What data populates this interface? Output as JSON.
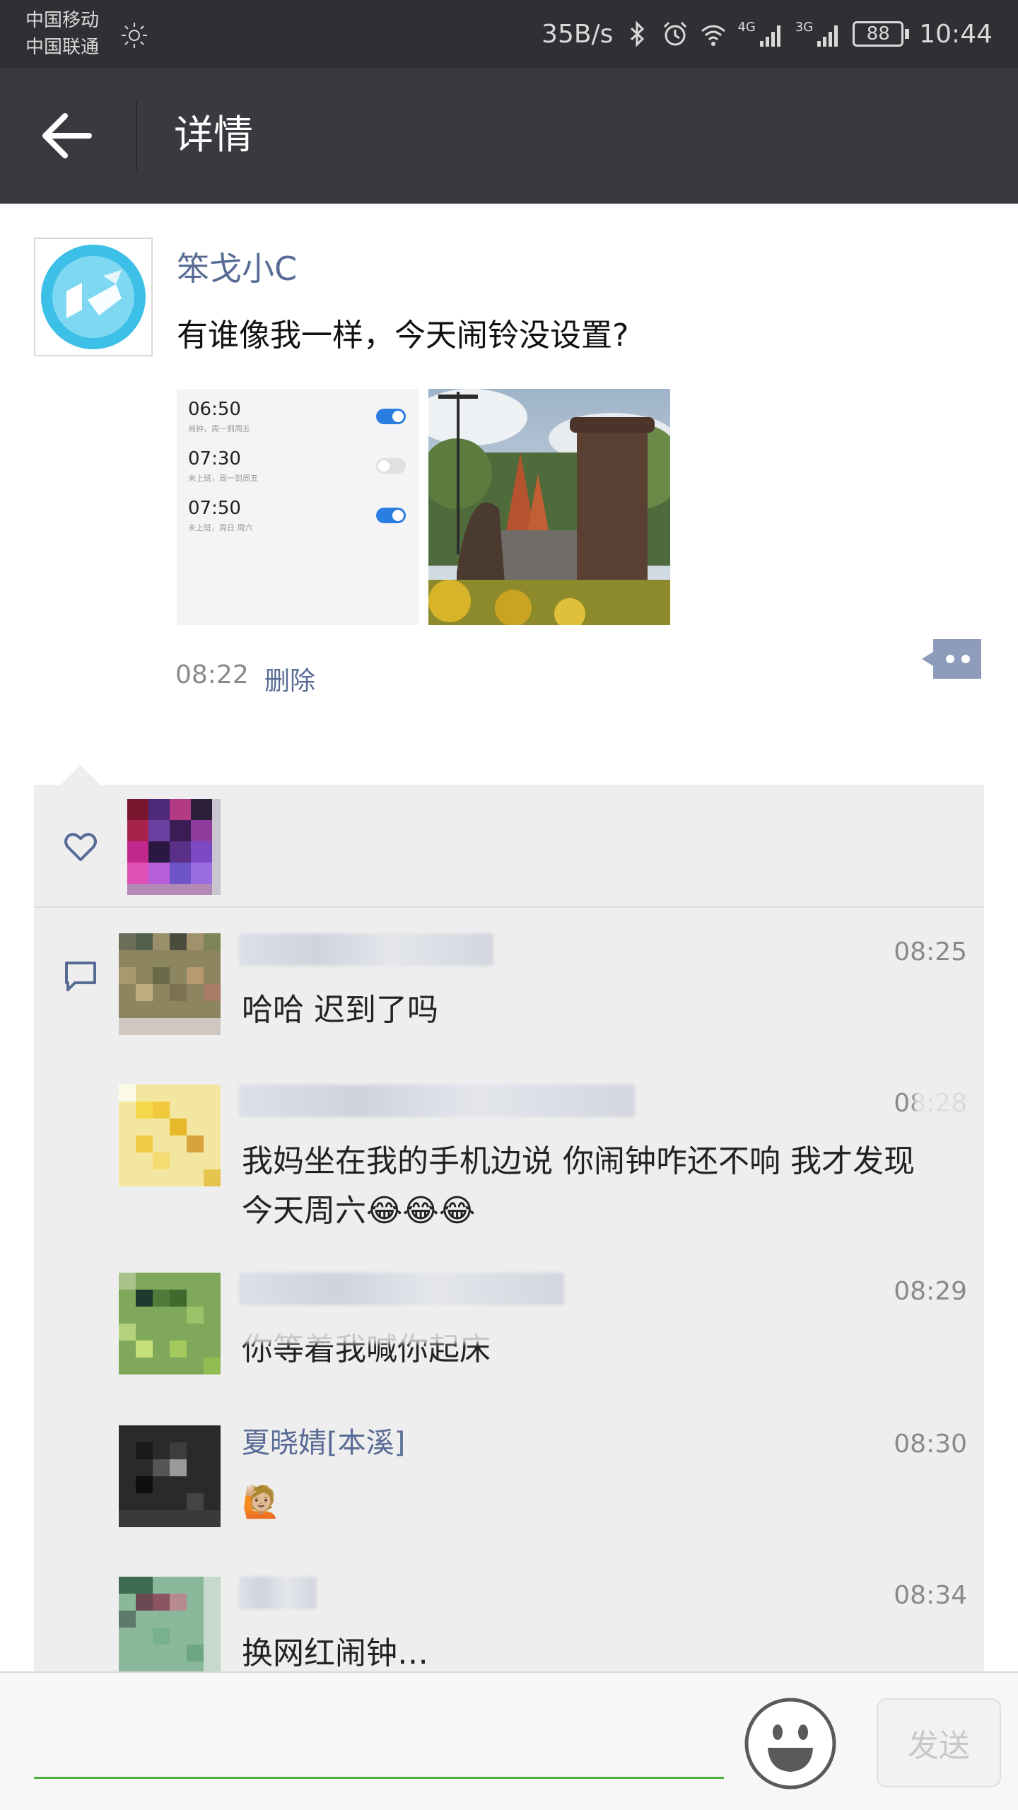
{
  "status_bar": {
    "carrier_1": "中国移动",
    "carrier_2": "中国联通",
    "speed": "35B/s",
    "net_1": "4G",
    "net_2": "3G",
    "battery": "88",
    "time": "10:44"
  },
  "header": {
    "title": "详情"
  },
  "post": {
    "author": "笨戈小C",
    "text": "有谁像我一样，今天闹铃没设置?",
    "time": "08:22",
    "delete_label": "删除",
    "alarms": [
      {
        "time": "06:50",
        "sub": "闹钟，周一到周五",
        "enabled": true
      },
      {
        "time": "07:30",
        "sub": "未上班，周一到周五",
        "enabled": false
      },
      {
        "time": "07:50",
        "sub": "未上班，周日 周六",
        "enabled": true
      }
    ]
  },
  "comments": [
    {
      "name": "",
      "time": "08:25",
      "text": "哈哈 迟到了吗"
    },
    {
      "name": "",
      "time": "08:28",
      "text": "我妈坐在我的手机边说 你闹钟咋还不响 我才发现今天周六😂😂😂"
    },
    {
      "name": "",
      "time": "08:29",
      "text": "你等着我喊你起床"
    },
    {
      "name": "夏晓婧[本溪]",
      "time": "08:30",
      "text": "🙋🏼"
    },
    {
      "name": "",
      "time": "08:34",
      "text": "换网红闹钟…"
    }
  ],
  "input": {
    "placeholder": "",
    "send_label": "发送"
  },
  "colors": {
    "link": "#576b95",
    "titlebar": "#393a3f",
    "statusbar": "#2f3034",
    "panel": "#eeeeee",
    "input_underline": "#4cb33d"
  }
}
